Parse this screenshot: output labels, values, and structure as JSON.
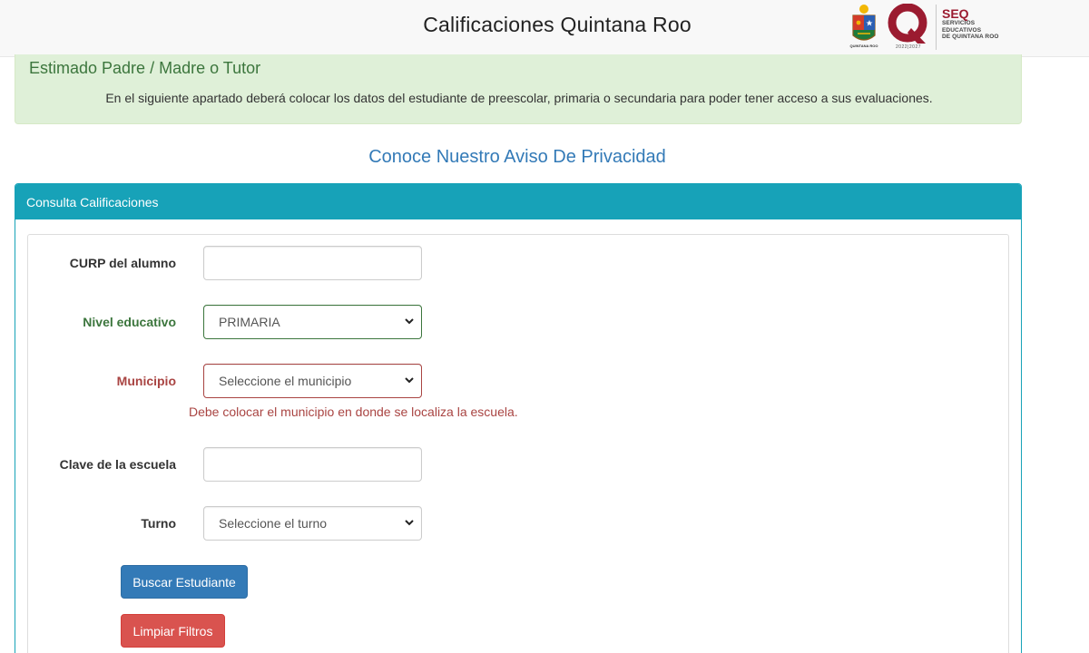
{
  "header": {
    "title": "Calificaciones Quintana Roo",
    "crest_caption": "QUINTANA ROO",
    "q_caption": "2022|2027",
    "seq": {
      "acronym": "SEQ",
      "line1": "SERVICIOS",
      "line2": "EDUCATIVOS",
      "line3": "DE QUINTANA ROO"
    }
  },
  "notice": {
    "heading": "Estimado Padre / Madre o Tutor",
    "text": "En el siguiente apartado deberá colocar los datos del estudiante de preescolar, primaria o secundaria para poder tener acceso a sus evaluaciones."
  },
  "privacy_link": "Conoce Nuestro Aviso De Privacidad",
  "panel": {
    "title": "Consulta Calificaciones"
  },
  "form": {
    "curp": {
      "label": "CURP del alumno",
      "value": ""
    },
    "nivel": {
      "label": "Nivel educativo",
      "selected": "PRIMARIA"
    },
    "municipio": {
      "label": "Municipio",
      "selected": "Seleccione el municipio",
      "error": "Debe colocar el municipio en donde se localiza la escuela."
    },
    "clave": {
      "label": "Clave de la escuela",
      "value": ""
    },
    "turno": {
      "label": "Turno",
      "selected": "Seleccione el turno"
    }
  },
  "buttons": {
    "search": "Buscar Estudiante",
    "clear": "Limpiar Filtros"
  },
  "colors": {
    "panel_accent": "#17a2b8",
    "success": "#3c763d",
    "error": "#a94442",
    "primary": "#337ab7",
    "danger": "#d9534f"
  }
}
